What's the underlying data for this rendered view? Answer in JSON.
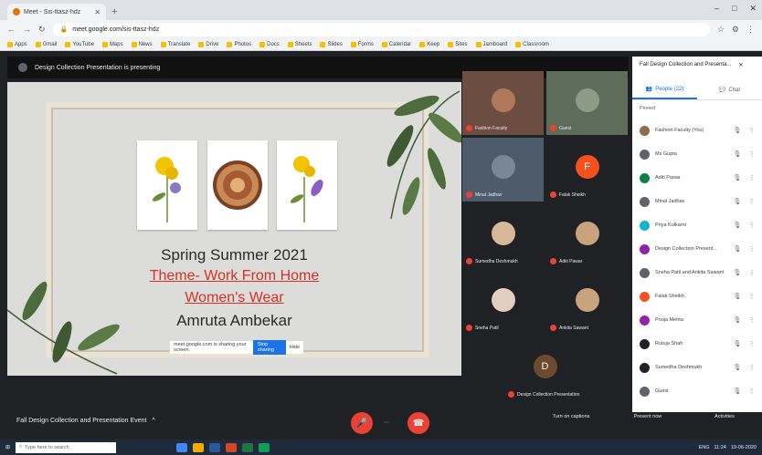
{
  "browser": {
    "tab_title": "Meet - Sis-ttasz-hdz",
    "new_tab": "+",
    "url": "meet.google.com/sis-ttasz-hdz",
    "window_controls": [
      "–",
      "□",
      "✕"
    ],
    "bookmarks": [
      "Apps",
      "Gmail",
      "YouTube",
      "Maps",
      "News",
      "Translate",
      "Drive",
      "Photos",
      "Docs",
      "Sheets",
      "Slides",
      "Forms",
      "Calendar",
      "Keep",
      "Sites",
      "Jamboard",
      "Classroom"
    ]
  },
  "meeting": {
    "presenter_banner": "Design Collection Presentation is presenting",
    "title": "Fall Design Collection and Presentation Event",
    "title_chevron": "^",
    "captions_hint": "CC"
  },
  "slide": {
    "line1": "Spring Summer 2021",
    "line2": "Theme- Work From Home",
    "line3": "Women's Wear",
    "line4": "Amruta Ambekar",
    "stop_text": "meet.google.com is sharing your screen.",
    "stop_button": "Stop sharing",
    "hide_button": "Hide"
  },
  "tiles": [
    {
      "name": "Fashion Faculty",
      "initial": ""
    },
    {
      "name": "Guest",
      "initial": ""
    },
    {
      "name": "Minal Jadhav",
      "initial": ""
    },
    {
      "name": "Falak Sheikh",
      "initial": "F"
    },
    {
      "name": "Sumedha Deshmukh",
      "initial": ""
    },
    {
      "name": "Aditi Pawar",
      "initial": ""
    },
    {
      "name": "Sneha Patil",
      "initial": ""
    },
    {
      "name": "Ankita Sawant",
      "initial": ""
    },
    {
      "name": "Design Collection Presentation",
      "initial": "D"
    }
  ],
  "controls": {
    "mic_label": "🎤",
    "more_label": "⋯",
    "end_label": "☎",
    "right_labels": [
      "Turn on captions",
      "Present now",
      "Activities"
    ]
  },
  "panel": {
    "header": "Fall Design Collection and Presenta...",
    "tab_people": "People (22)",
    "tab_chat": "Chat",
    "section_label": "Pinned",
    "participants": [
      {
        "name": "Fashion Faculty (You)",
        "color": "#8e6c4e"
      },
      {
        "name": "Ms Gupta",
        "color": "#5f6368"
      },
      {
        "name": "Aditi Pawar",
        "color": "#0b8043"
      },
      {
        "name": "Minal Jadhav",
        "color": "#5f6368"
      },
      {
        "name": "Priya Kulkarni",
        "color": "#12b5cb"
      },
      {
        "name": "Design Collection Present...",
        "color": "#8e24aa"
      },
      {
        "name": "Sneha Patil and Ankita Sawant",
        "color": "#5f6368"
      },
      {
        "name": "Falak Sheikh",
        "color": "#f4511e"
      },
      {
        "name": "Pooja Mehta",
        "color": "#8e24aa"
      },
      {
        "name": "Rutuja Shah",
        "color": "#202124"
      },
      {
        "name": "Sumedha Deshmukh",
        "color": "#202124"
      },
      {
        "name": "Guest",
        "color": "#5f6368"
      }
    ]
  },
  "taskbar": {
    "search_placeholder": "Type here to search",
    "tray": [
      "ENG",
      "11:24",
      "19-06-2020"
    ]
  }
}
